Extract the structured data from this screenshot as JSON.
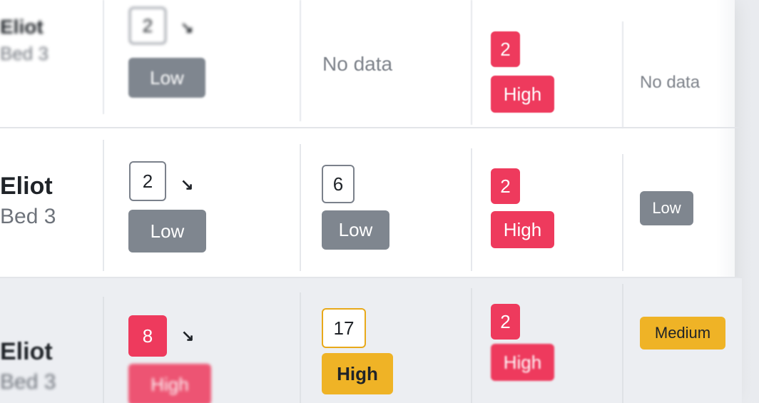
{
  "rows": [
    {
      "patient": {
        "name": "Eliot",
        "bed": "Bed 3"
      },
      "c1": {
        "score": "2",
        "trend_icon": "arrow-down-right-icon",
        "trend_glyph": "↘",
        "level": "Low"
      },
      "c2": {
        "text": "No data"
      },
      "c3": {
        "score": "2",
        "level": "High"
      },
      "c4": {
        "text": "No data"
      }
    },
    {
      "patient": {
        "name": "Eliot",
        "bed": "Bed 3"
      },
      "c1": {
        "score": "2",
        "trend_icon": "arrow-down-right-icon",
        "trend_glyph": "↘",
        "level": "Low"
      },
      "c2": {
        "score": "6",
        "level": "Low"
      },
      "c3": {
        "score": "2",
        "level": "High"
      },
      "c4": {
        "level": "Low"
      }
    },
    {
      "patient": {
        "name": "Eliot",
        "bed": "Bed 3"
      },
      "c1": {
        "score": "8",
        "trend_icon": "arrow-down-right-icon",
        "trend_glyph": "↘",
        "level": "High"
      },
      "c2": {
        "score": "17",
        "level": "High"
      },
      "c3": {
        "score": "2",
        "level": "High"
      },
      "c4": {
        "level": "Medium"
      }
    }
  ],
  "colors": {
    "low": "#7f868f",
    "high": "#ee3a5d",
    "medium": "#efb326",
    "selected_row_bg": "#eceef2"
  }
}
